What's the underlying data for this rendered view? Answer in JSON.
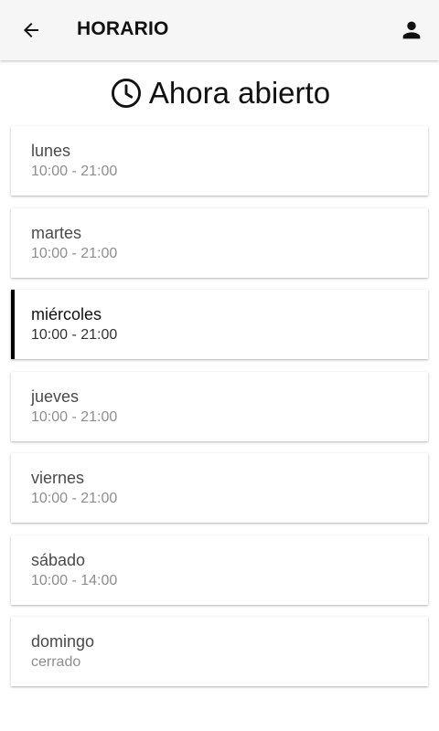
{
  "header": {
    "title": "HORARIO",
    "back_icon": "arrow-left-icon",
    "account_icon": "person-icon"
  },
  "status": {
    "icon": "clock-icon",
    "text": "Ahora abierto"
  },
  "days": [
    {
      "name": "lunes",
      "hours": "10:00 - 21:00",
      "current": false
    },
    {
      "name": "martes",
      "hours": "10:00 - 21:00",
      "current": false
    },
    {
      "name": "miércoles",
      "hours": "10:00 - 21:00",
      "current": true
    },
    {
      "name": "jueves",
      "hours": "10:00 - 21:00",
      "current": false
    },
    {
      "name": "viernes",
      "hours": "10:00 - 21:00",
      "current": false
    },
    {
      "name": "sábado",
      "hours": "10:00 - 14:00",
      "current": false
    },
    {
      "name": "domingo",
      "hours": "cerrado",
      "current": false
    }
  ],
  "colors": {
    "header_bg": "#f5f6f5",
    "current_marker": "#000000",
    "day_name": "#4a4a4a",
    "hours_text": "#8e8e8e"
  }
}
